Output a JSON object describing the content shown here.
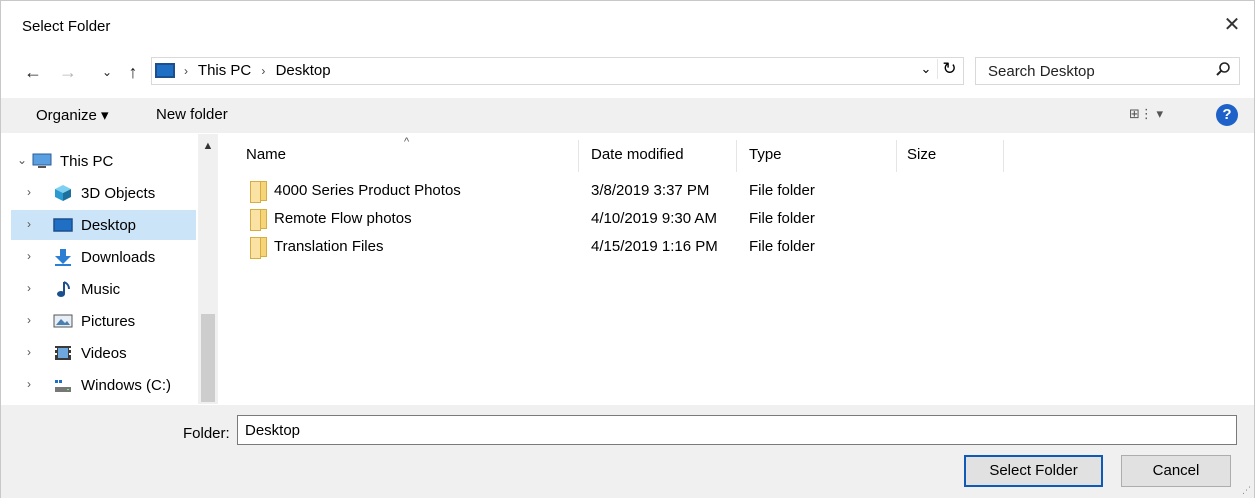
{
  "window": {
    "title": "Select Folder",
    "close_glyph": "✕"
  },
  "nav": {
    "back": "←",
    "forward": "→",
    "recent": "⌄",
    "up": "↑",
    "breadcrumbs": [
      "This PC",
      "Desktop"
    ],
    "separator": "›",
    "dropdown": "⌄",
    "refresh": "↻"
  },
  "search": {
    "placeholder": "Search Desktop",
    "icon": "search-icon"
  },
  "toolbar": {
    "organize": "Organize ▾",
    "new_folder": "New folder",
    "view": "⊞⋮ ▾",
    "help": "?"
  },
  "sidebar": {
    "items": [
      {
        "label": "This PC",
        "chevron": "⌄",
        "icon": "pc-icon"
      },
      {
        "label": "3D Objects",
        "chevron": "›",
        "icon": "cube-icon"
      },
      {
        "label": "Desktop",
        "chevron": "›",
        "icon": "desktop-icon",
        "selected": true
      },
      {
        "label": "Downloads",
        "chevron": "›",
        "icon": "download-icon"
      },
      {
        "label": "Music",
        "chevron": "›",
        "icon": "music-icon"
      },
      {
        "label": "Pictures",
        "chevron": "›",
        "icon": "pictures-icon"
      },
      {
        "label": "Videos",
        "chevron": "›",
        "icon": "video-icon"
      },
      {
        "label": "Windows (C:)",
        "chevron": "›",
        "icon": "drive-icon"
      }
    ],
    "scroll_up": "▲"
  },
  "filelist": {
    "columns": [
      "Name",
      "Date modified",
      "Type",
      "Size"
    ],
    "sort_glyph": "^",
    "rows": [
      {
        "name": "4000 Series Product Photos",
        "date": "3/8/2019 3:37 PM",
        "type": "File folder"
      },
      {
        "name": "Remote Flow photos",
        "date": "4/10/2019 9:30 AM",
        "type": "File folder"
      },
      {
        "name": "Translation Files",
        "date": "4/15/2019 1:16 PM",
        "type": "File folder"
      }
    ]
  },
  "footer": {
    "folder_label": "Folder:",
    "folder_value": "Desktop",
    "select_button": "Select Folder",
    "cancel_button": "Cancel"
  },
  "colors": {
    "selection": "#cce4f7",
    "toolbar_bg": "#f0f0f0",
    "accent": "#0f5ab6"
  }
}
